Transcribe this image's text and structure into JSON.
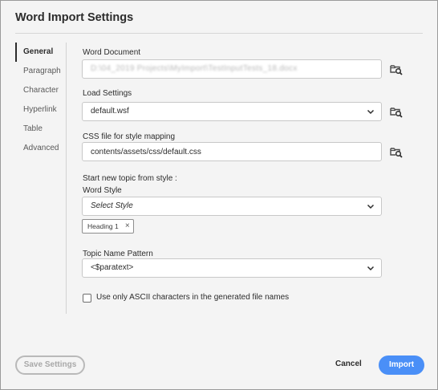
{
  "dialog": {
    "title": "Word Import Settings"
  },
  "sidebar": {
    "items": [
      {
        "label": "General",
        "active": true
      },
      {
        "label": "Paragraph"
      },
      {
        "label": "Character"
      },
      {
        "label": "Hyperlink"
      },
      {
        "label": "Table"
      },
      {
        "label": "Advanced"
      }
    ]
  },
  "word_document": {
    "label": "Word Document",
    "value": "D:\\04_2019 Projects\\MyImport\\TestInputTests_18.docx"
  },
  "load_settings": {
    "label": "Load Settings",
    "value": "default.wsf"
  },
  "css_file": {
    "label": "CSS file for style mapping",
    "value": "contents/assets/css/default.css"
  },
  "topic_split": {
    "heading": "Start new topic from style :",
    "word_style_label": "Word Style",
    "word_style_placeholder": "Select Style",
    "selected_tags": [
      "Heading 1"
    ],
    "remove_tag_glyph": "×"
  },
  "topic_name": {
    "label": "Topic Name Pattern",
    "value": "<$paratext>"
  },
  "ascii_option": {
    "label": "Use only ASCII characters in the generated file names",
    "checked": false
  },
  "footer": {
    "save_label": "Save Settings",
    "cancel_label": "Cancel",
    "import_label": "Import"
  },
  "icons": {
    "browse": "folder-search-icon",
    "dropdown": "chevron-down-icon"
  },
  "colors": {
    "primary": "#4a8ff7",
    "background": "#f4f4f4"
  }
}
